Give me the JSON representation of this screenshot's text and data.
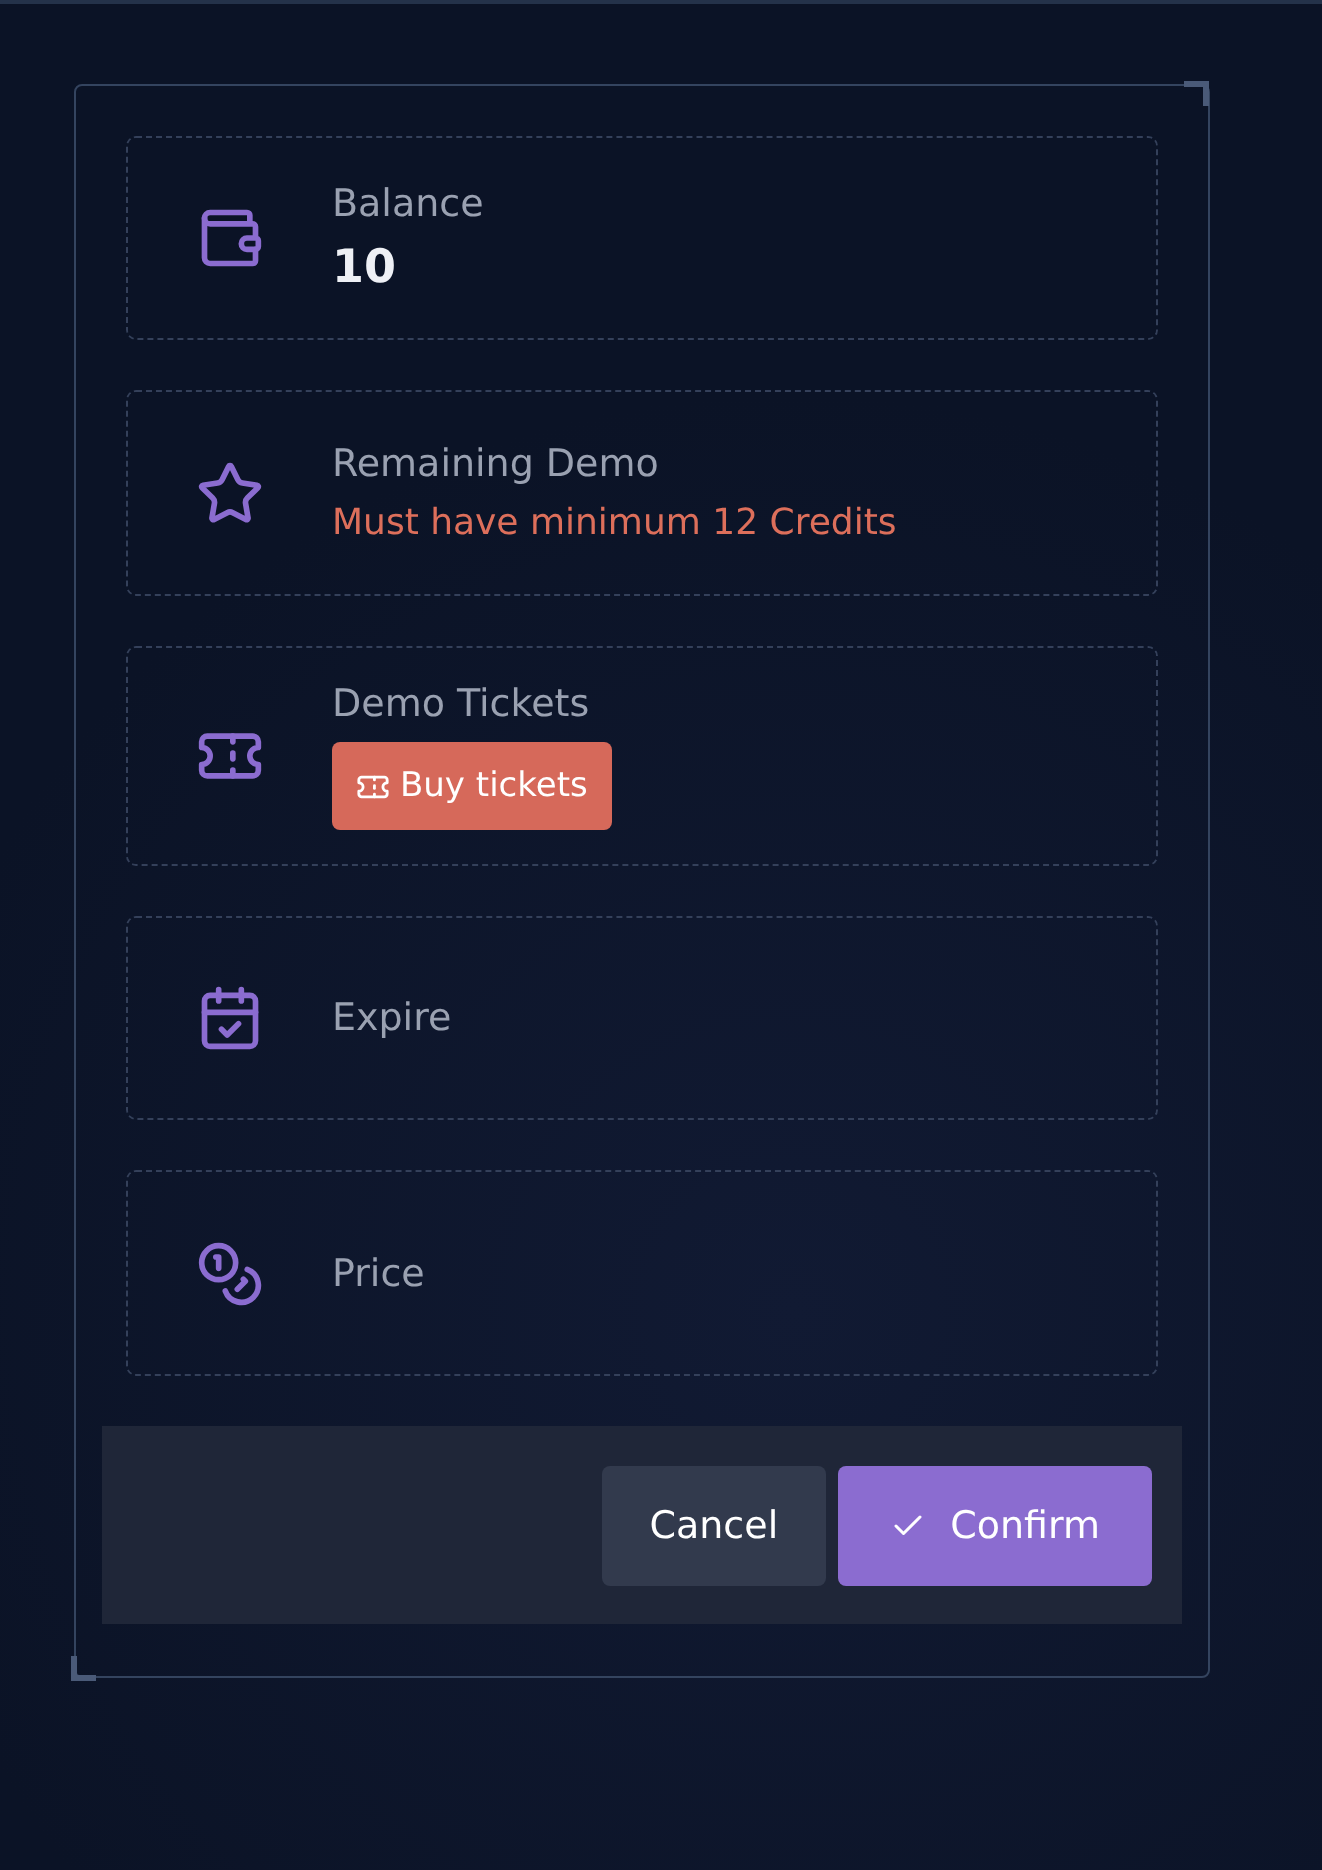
{
  "items": [
    {
      "label": "Balance",
      "kind": "value",
      "value": "10"
    },
    {
      "label": "Remaining Demo",
      "kind": "error",
      "value": "Must have minimum 12 Credits"
    },
    {
      "label": "Demo Tickets",
      "kind": "action",
      "value": "Buy tickets"
    },
    {
      "label": "Expire",
      "kind": "empty"
    },
    {
      "label": "Price",
      "kind": "empty"
    }
  ],
  "buttons": [
    {
      "label": "Cancel",
      "kind": "secondary"
    },
    {
      "label": "Confirm",
      "kind": "primary"
    }
  ]
}
